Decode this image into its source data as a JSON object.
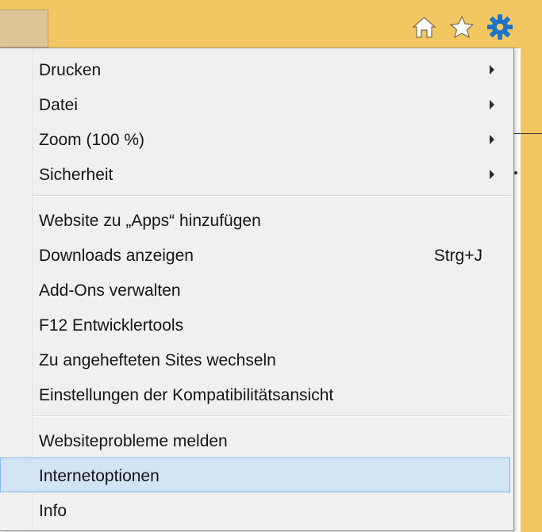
{
  "toolbar": {
    "icons": [
      {
        "name": "home-icon",
        "color": "#ffffff"
      },
      {
        "name": "star-icon",
        "color": "#ffffff"
      },
      {
        "name": "gear-icon",
        "color": "#1e73c9"
      }
    ]
  },
  "menu": {
    "items": [
      {
        "label": "Drucken",
        "submenu": true
      },
      {
        "label": "Datei",
        "submenu": true
      },
      {
        "label": "Zoom (100 %)",
        "submenu": true
      },
      {
        "label": "Sicherheit",
        "submenu": true
      },
      {
        "label": "Website zu „Apps“ hinzufügen"
      },
      {
        "label": "Downloads anzeigen",
        "shortcut": "Strg+J"
      },
      {
        "label": "Add-Ons verwalten"
      },
      {
        "label": "F12 Entwicklertools"
      },
      {
        "label": "Zu angehefteten Sites wechseln"
      },
      {
        "label": "Einstellungen der Kompatibilitätsansicht"
      },
      {
        "label": "Websiteprobleme melden"
      },
      {
        "label": "Internetoptionen",
        "highlighted": true
      },
      {
        "label": "Info"
      }
    ]
  },
  "colors": {
    "window_background": "#f2c661",
    "menu_background": "#f0f0f0",
    "menu_highlight": "#d2e3f3",
    "menu_highlight_border": "#84b7e7"
  }
}
